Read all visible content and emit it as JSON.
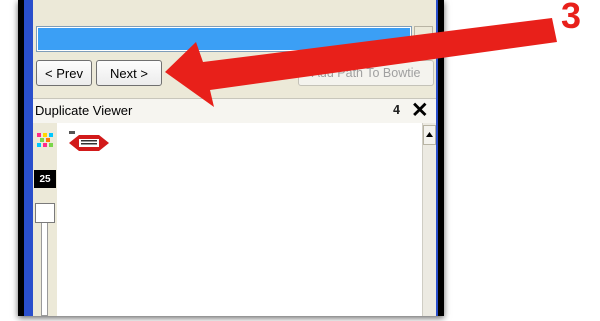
{
  "progress": {
    "fraction": 1.0,
    "color": "#3b9ff5"
  },
  "buttons": {
    "prev_label": "< Prev",
    "next_label": "Next >",
    "add_path_label": "Add Path To Bowtie"
  },
  "panel": {
    "title": "Duplicate Viewer",
    "pin_icon": "pin-icon",
    "close_icon": "close-icon"
  },
  "toolbar": {
    "zoom_value": "25"
  },
  "annotation": {
    "step_number": "3",
    "arrow_color": "#e8201a"
  },
  "colors": {
    "window_blue": "#2a4fcc",
    "chrome": "#ece9d8"
  }
}
